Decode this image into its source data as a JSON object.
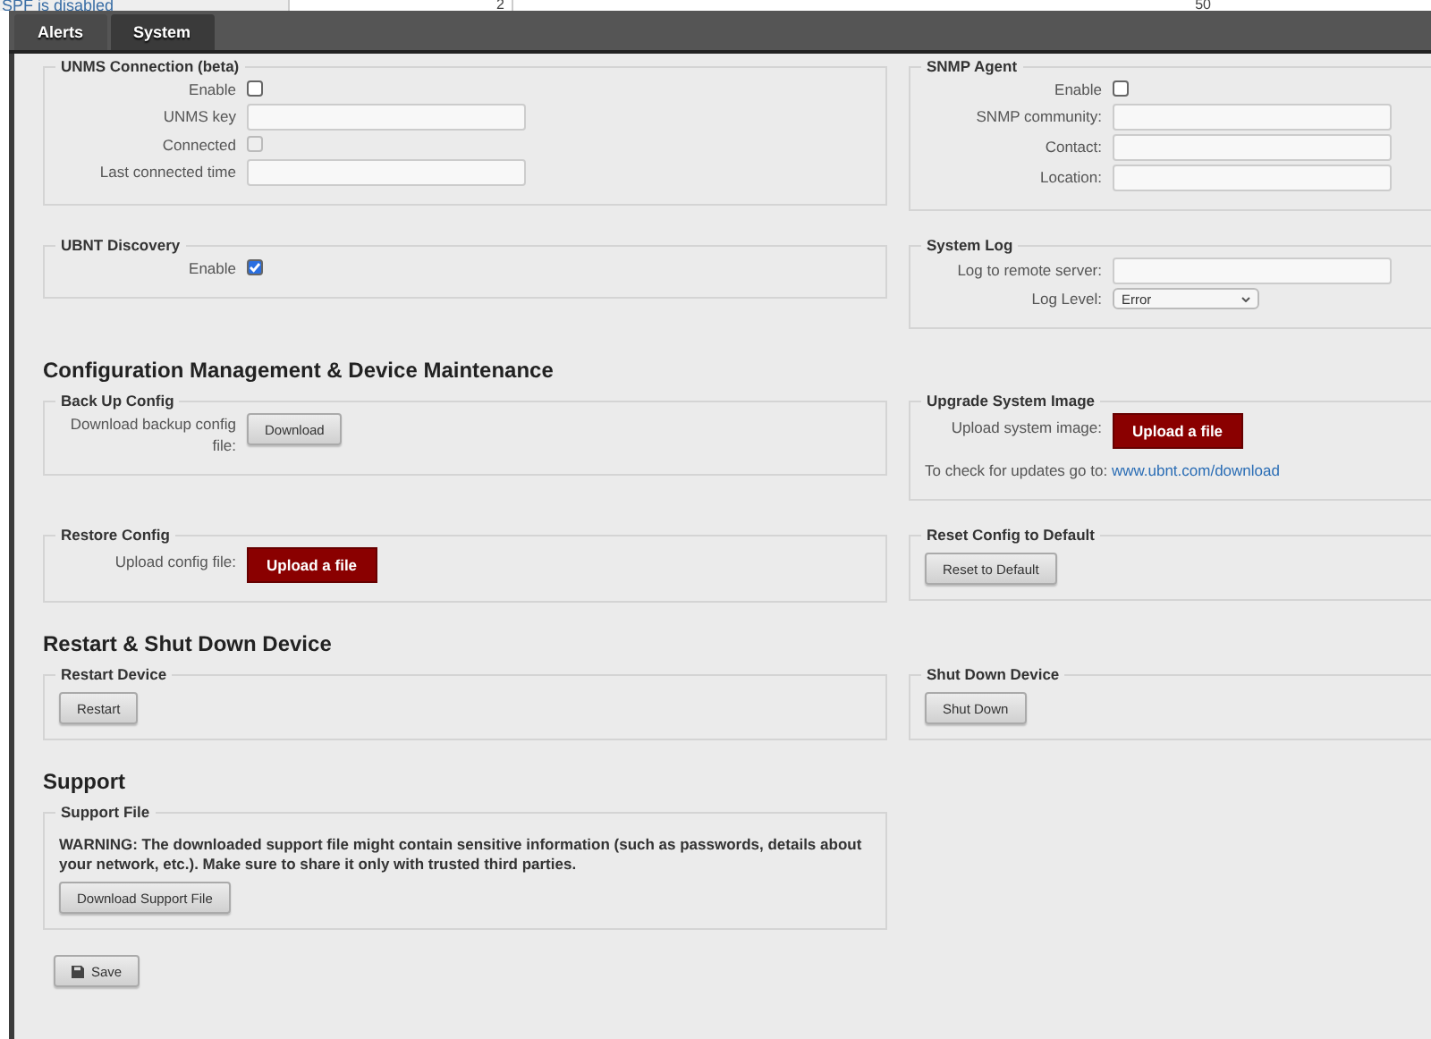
{
  "background_page": {
    "status_text": "SPF is disabled",
    "cell_1": "2",
    "cell_2": "50"
  },
  "tabs": [
    {
      "label": "Alerts",
      "selected": false
    },
    {
      "label": "System",
      "selected": true
    }
  ],
  "groups": [
    {
      "panels": [
        {
          "legend": "UNMS Connection (beta)",
          "rows": [
            {
              "kind": "checkbox",
              "label": "Enable",
              "checked": false,
              "disabled": false
            },
            {
              "kind": "text",
              "label": "UNMS key"
            },
            {
              "kind": "checkbox",
              "label": "Connected",
              "checked": false,
              "disabled": true
            },
            {
              "kind": "text",
              "label": "Last connected time"
            }
          ]
        },
        {
          "legend": "SNMP Agent",
          "rows": [
            {
              "kind": "checkbox",
              "label": "Enable",
              "checked": false,
              "disabled": false
            },
            {
              "kind": "text",
              "label": "SNMP community:"
            },
            {
              "kind": "text",
              "label": "Contact:"
            },
            {
              "kind": "text",
              "label": "Location:"
            }
          ]
        }
      ]
    },
    {
      "panels": [
        {
          "legend": "UBNT Discovery",
          "rows": [
            {
              "kind": "checkbox",
              "label": "Enable",
              "checked": true,
              "disabled": false
            }
          ]
        },
        {
          "legend": "System Log",
          "rows": [
            {
              "kind": "text",
              "label": "Log to remote server:"
            },
            {
              "kind": "select",
              "label": "Log Level:",
              "value": "Error"
            }
          ]
        }
      ]
    },
    {
      "heading": "Configuration Management & Device Maintenance",
      "panels": [
        {
          "legend": "Back Up Config",
          "rows": [
            {
              "kind": "button",
              "label": "Download backup config file:",
              "button": "Download"
            }
          ]
        },
        {
          "legend": "Upgrade System Image",
          "rows": [
            {
              "kind": "upload",
              "label": "Upload system image:",
              "button": "Upload a file"
            },
            {
              "kind": "note",
              "text": "To check for updates go to:",
              "link": "www.ubnt.com/download"
            }
          ]
        }
      ]
    },
    {
      "panels": [
        {
          "legend": "Restore Config",
          "rows": [
            {
              "kind": "upload",
              "label": "Upload config file:",
              "button": "Upload a file"
            }
          ]
        },
        {
          "legend": "Reset Config to Default",
          "rows": [
            {
              "kind": "plain-button",
              "button": "Reset to Default"
            }
          ]
        }
      ]
    },
    {
      "heading": "Restart & Shut Down Device",
      "panels": [
        {
          "legend": "Restart Device",
          "rows": [
            {
              "kind": "plain-button",
              "button": "Restart"
            }
          ]
        },
        {
          "legend": "Shut Down Device",
          "rows": [
            {
              "kind": "plain-button",
              "button": "Shut Down"
            }
          ]
        }
      ]
    },
    {
      "heading": "Support",
      "panels": [
        {
          "legend": "Support File",
          "rows": [
            {
              "kind": "warning",
              "text": "WARNING: The downloaded support file might contain sensitive information (such as passwords, details about your network, etc.). Make sure to share it only with trusted third parties."
            },
            {
              "kind": "plain-button",
              "button": "Download Support File"
            }
          ]
        }
      ]
    }
  ],
  "save_button": "Save"
}
